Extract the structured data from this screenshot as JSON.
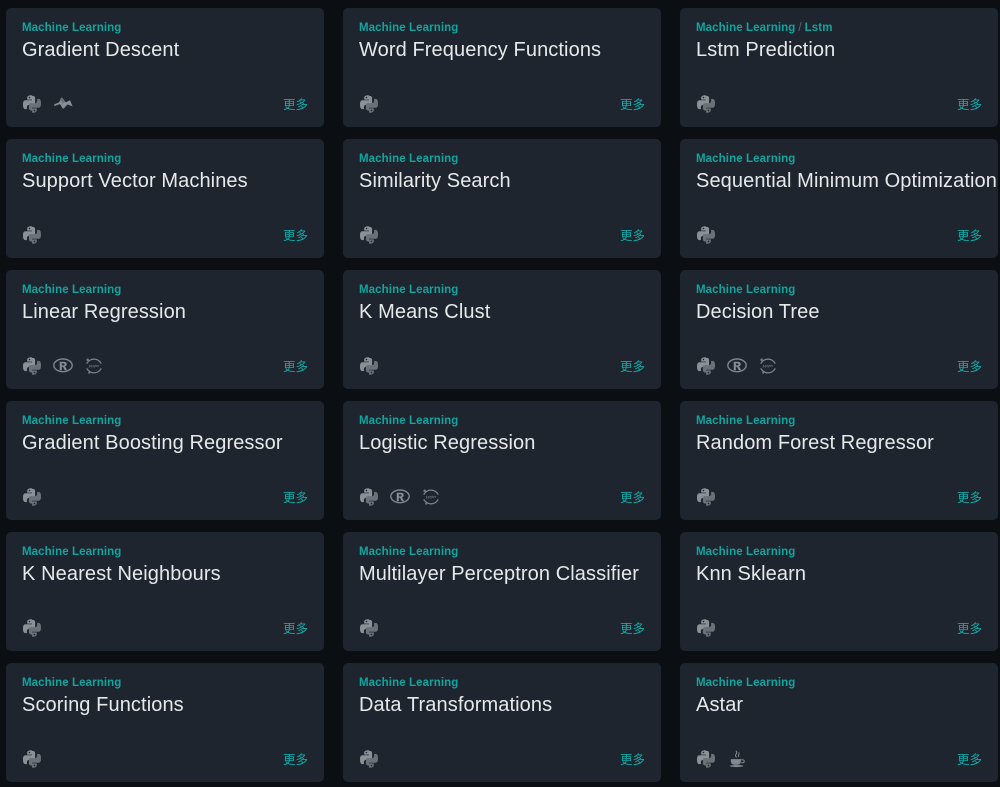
{
  "page": {
    "background_color": "#0b0f14",
    "card_background_color": "#1e252e",
    "accent_color": "#11a5a0",
    "title_color": "#e6e9ea",
    "more_label": "更多",
    "separator": "/"
  },
  "cards": [
    {
      "category": "Machine Learning",
      "subcategory": "",
      "title": "Gradient Descent",
      "icons": [
        "python-icon",
        "matlab-icon"
      ],
      "more_label": "更多"
    },
    {
      "category": "Machine Learning",
      "subcategory": "",
      "title": "Word Frequency Functions",
      "icons": [
        "python-icon"
      ],
      "more_label": "更多"
    },
    {
      "category": "Machine Learning",
      "subcategory": "Lstm",
      "title": "Lstm Prediction",
      "icons": [
        "python-icon"
      ],
      "more_label": "更多"
    },
    {
      "category": "Machine Learning",
      "subcategory": "",
      "title": "Support Vector Machines",
      "icons": [
        "python-icon"
      ],
      "more_label": "更多"
    },
    {
      "category": "Machine Learning",
      "subcategory": "",
      "title": "Similarity Search",
      "icons": [
        "python-icon"
      ],
      "more_label": "更多"
    },
    {
      "category": "Machine Learning",
      "subcategory": "",
      "title": "Sequential Minimum Optimization",
      "icons": [
        "python-icon"
      ],
      "more_label": "更多"
    },
    {
      "category": "Machine Learning",
      "subcategory": "",
      "title": "Linear Regression",
      "icons": [
        "python-icon",
        "r-icon",
        "jupyter-icon"
      ],
      "more_label": "更多"
    },
    {
      "category": "Machine Learning",
      "subcategory": "",
      "title": "K Means Clust",
      "icons": [
        "python-icon"
      ],
      "more_label": "更多"
    },
    {
      "category": "Machine Learning",
      "subcategory": "",
      "title": "Decision Tree",
      "icons": [
        "python-icon",
        "r-icon",
        "jupyter-icon"
      ],
      "more_label": "更多"
    },
    {
      "category": "Machine Learning",
      "subcategory": "",
      "title": "Gradient Boosting Regressor",
      "icons": [
        "python-icon"
      ],
      "more_label": "更多"
    },
    {
      "category": "Machine Learning",
      "subcategory": "",
      "title": "Logistic Regression",
      "icons": [
        "python-icon",
        "r-icon",
        "jupyter-icon"
      ],
      "more_label": "更多"
    },
    {
      "category": "Machine Learning",
      "subcategory": "",
      "title": "Random Forest Regressor",
      "icons": [
        "python-icon"
      ],
      "more_label": "更多"
    },
    {
      "category": "Machine Learning",
      "subcategory": "",
      "title": "K Nearest Neighbours",
      "icons": [
        "python-icon"
      ],
      "more_label": "更多"
    },
    {
      "category": "Machine Learning",
      "subcategory": "",
      "title": "Multilayer Perceptron Classifier",
      "icons": [
        "python-icon"
      ],
      "more_label": "更多"
    },
    {
      "category": "Machine Learning",
      "subcategory": "",
      "title": "Knn Sklearn",
      "icons": [
        "python-icon"
      ],
      "more_label": "更多"
    },
    {
      "category": "Machine Learning",
      "subcategory": "",
      "title": "Scoring Functions",
      "icons": [
        "python-icon"
      ],
      "more_label": "更多"
    },
    {
      "category": "Machine Learning",
      "subcategory": "",
      "title": "Data Transformations",
      "icons": [
        "python-icon"
      ],
      "more_label": "更多"
    },
    {
      "category": "Machine Learning",
      "subcategory": "",
      "title": "Astar",
      "icons": [
        "python-icon",
        "java-icon"
      ],
      "more_label": "更多"
    }
  ]
}
